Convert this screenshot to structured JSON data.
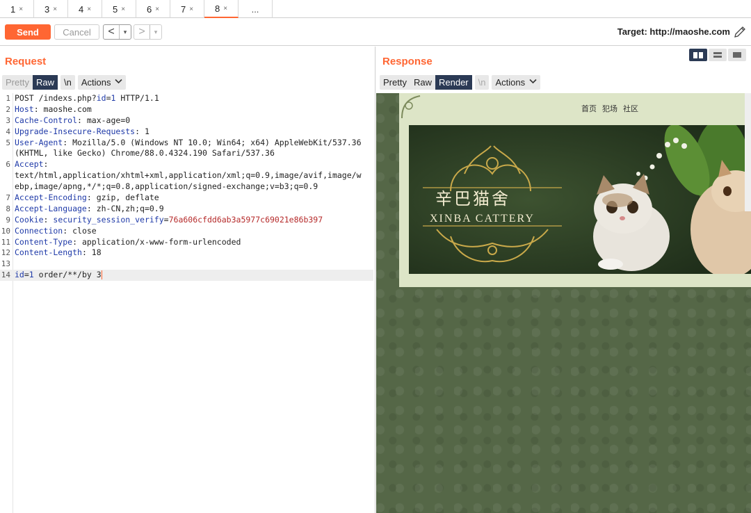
{
  "tabs": [
    {
      "label": "1",
      "close": "×"
    },
    {
      "label": "3",
      "close": "×"
    },
    {
      "label": "4",
      "close": "×"
    },
    {
      "label": "5",
      "close": "×"
    },
    {
      "label": "6",
      "close": "×"
    },
    {
      "label": "7",
      "close": "×"
    },
    {
      "label": "8",
      "close": "×",
      "active": true
    }
  ],
  "tabs_more": "...",
  "toolbar": {
    "send_label": "Send",
    "cancel_label": "Cancel",
    "back_arrow": "<",
    "forward_arrow": ">",
    "dropdown_glyph": "▾",
    "target_label": "Target: http://maoshe.com"
  },
  "request": {
    "title": "Request",
    "subtabs": {
      "pretty": "Pretty",
      "raw": "Raw",
      "newline": "\\n",
      "actions": "Actions"
    },
    "lines": [
      {
        "n": "1",
        "parts": [
          {
            "t": "POST /indexs.php?",
            "c": "v"
          },
          {
            "t": "id",
            "c": "k"
          },
          {
            "t": "=",
            "c": "v"
          },
          {
            "t": "1",
            "c": "k"
          },
          {
            "t": " HTTP/1.1",
            "c": "v"
          }
        ]
      },
      {
        "n": "2",
        "parts": [
          {
            "t": "Host",
            "c": "k"
          },
          {
            "t": ": maoshe.com",
            "c": "v"
          }
        ]
      },
      {
        "n": "3",
        "parts": [
          {
            "t": "Cache-Control",
            "c": "k"
          },
          {
            "t": ": max-age=0",
            "c": "v"
          }
        ]
      },
      {
        "n": "4",
        "parts": [
          {
            "t": "Upgrade-Insecure-Requests",
            "c": "k"
          },
          {
            "t": ": 1",
            "c": "v"
          }
        ]
      },
      {
        "n": "5",
        "parts": [
          {
            "t": "User-Agent",
            "c": "k"
          },
          {
            "t": ": Mozilla/5.0 (Windows NT 10.0; Win64; x64) AppleWebKit/537.36",
            "c": "v"
          }
        ]
      },
      {
        "n": "",
        "parts": [
          {
            "t": "(KHTML, like Gecko) Chrome/88.0.4324.190 Safari/537.36",
            "c": "v"
          }
        ]
      },
      {
        "n": "6",
        "parts": [
          {
            "t": "Accept",
            "c": "k"
          },
          {
            "t": ":",
            "c": "v"
          }
        ]
      },
      {
        "n": "",
        "parts": [
          {
            "t": "text/html,application/xhtml+xml,application/xml;q=0.9,image/avif,image/w",
            "c": "v"
          }
        ]
      },
      {
        "n": "",
        "parts": [
          {
            "t": "ebp,image/apng,*/*;q=0.8,application/signed-exchange;v=b3;q=0.9",
            "c": "v"
          }
        ]
      },
      {
        "n": "7",
        "parts": [
          {
            "t": "Accept-Encoding",
            "c": "k"
          },
          {
            "t": ": gzip, deflate",
            "c": "v"
          }
        ]
      },
      {
        "n": "8",
        "parts": [
          {
            "t": "Accept-Language",
            "c": "k"
          },
          {
            "t": ": zh-CN,zh;q=0.9",
            "c": "v"
          }
        ]
      },
      {
        "n": "9",
        "parts": [
          {
            "t": "Cookie",
            "c": "k"
          },
          {
            "t": ": ",
            "c": "v"
          },
          {
            "t": "security_session_verify",
            "c": "ck"
          },
          {
            "t": "=",
            "c": "v"
          },
          {
            "t": "76a606cfdd6ab3a5977c69021e86b397",
            "c": "cv"
          }
        ]
      },
      {
        "n": "10",
        "parts": [
          {
            "t": "Connection",
            "c": "k"
          },
          {
            "t": ": close",
            "c": "v"
          }
        ]
      },
      {
        "n": "11",
        "parts": [
          {
            "t": "Content-Type",
            "c": "k"
          },
          {
            "t": ": application/x-www-form-urlencoded",
            "c": "v"
          }
        ]
      },
      {
        "n": "12",
        "parts": [
          {
            "t": "Content-Length",
            "c": "k"
          },
          {
            "t": ": 18",
            "c": "v"
          }
        ]
      },
      {
        "n": "13",
        "parts": []
      },
      {
        "n": "14",
        "cur": true,
        "parts": [
          {
            "t": "id",
            "c": "k"
          },
          {
            "t": "=",
            "c": "v"
          },
          {
            "t": "1",
            "c": "k"
          },
          {
            "t": " order/**/by 3",
            "c": "v"
          }
        ]
      }
    ]
  },
  "response": {
    "title": "Response",
    "subtabs": {
      "pretty": "Pretty",
      "raw": "Raw",
      "render": "Render",
      "newline": "\\n",
      "actions": "Actions"
    },
    "render": {
      "nav": [
        "首页",
        "犯场",
        "社区"
      ],
      "logo_cn": "辛巴猫舍",
      "logo_en": "XINBA CATTERY"
    }
  },
  "colors": {
    "accent": "#ff6633",
    "selected_tab_bg": "#2b3a55",
    "header_key": "#1f3aa8",
    "cookie_value": "#b52a2a"
  }
}
